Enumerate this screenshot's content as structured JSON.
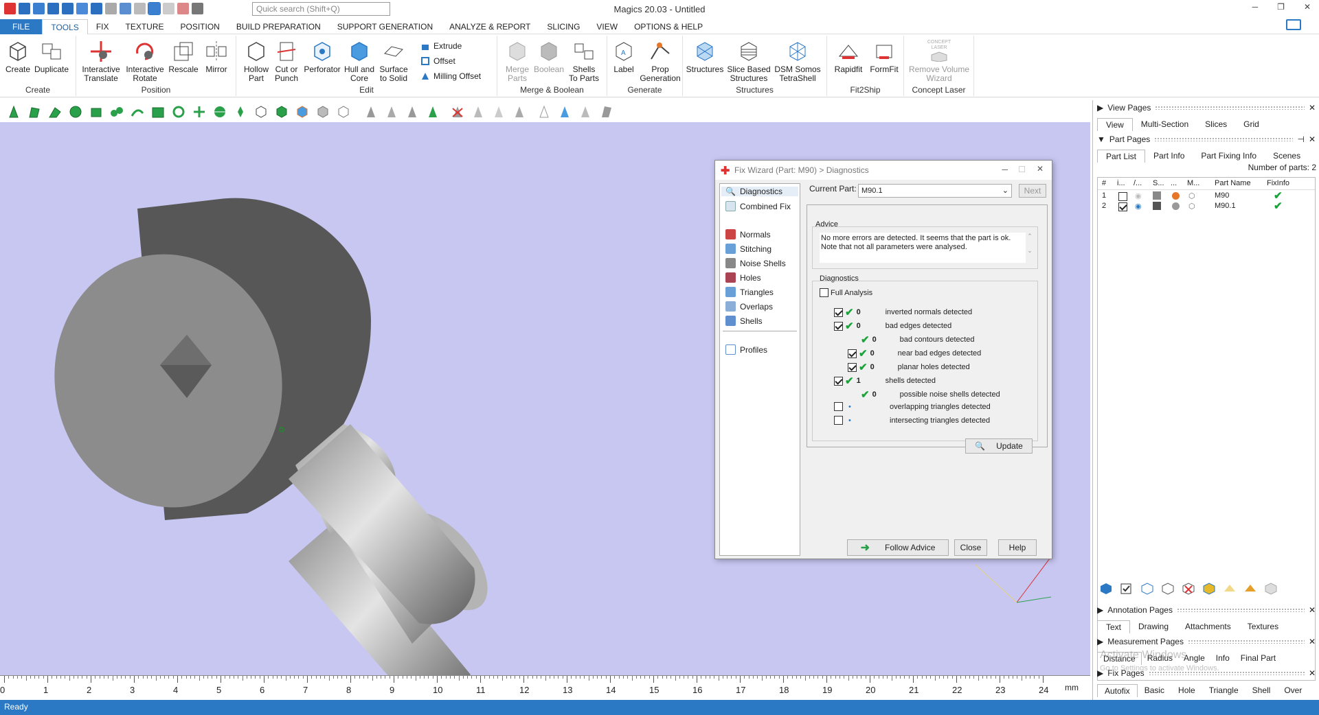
{
  "app": {
    "title": "Magics 20.03 - Untitled",
    "search_placeholder": "Quick search (Shift+Q)"
  },
  "menu": [
    "FILE",
    "TOOLS",
    "FIX",
    "TEXTURE",
    "POSITION",
    "BUILD PREPARATION",
    "SUPPORT GENERATION",
    "ANALYZE & REPORT",
    "SLICING",
    "VIEW",
    "OPTIONS & HELP"
  ],
  "ribbon": {
    "create": {
      "title": "Create",
      "create": "Create",
      "duplicate": "Duplicate"
    },
    "position": {
      "title": "Position",
      "translate1": "Interactive",
      "translate2": "Translate",
      "rotate1": "Interactive",
      "rotate2": "Rotate",
      "rescale": "Rescale",
      "mirror": "Mirror"
    },
    "edit": {
      "title": "Edit",
      "hollow1": "Hollow",
      "hollow2": "Part",
      "cut1": "Cut or",
      "cut2": "Punch",
      "perforator": "Perforator",
      "hull1": "Hull and",
      "hull2": "Core",
      "surface1": "Surface",
      "surface2": "to Solid",
      "extrude": "Extrude",
      "offset": "Offset",
      "milling": "Milling Offset"
    },
    "merge": {
      "title": "Merge & Boolean",
      "merge1": "Merge",
      "merge2": "Parts",
      "boolean": "Boolean",
      "shells1": "Shells",
      "shells2": "To Parts"
    },
    "generate": {
      "title": "Generate",
      "label": "Label",
      "prop1": "Prop",
      "prop2": "Generation"
    },
    "structures": {
      "title": "Structures",
      "structures": "Structures",
      "slice1": "Slice Based",
      "slice2": "Structures",
      "dsm1": "DSM Somos",
      "dsm2": "TetraShell"
    },
    "fit2ship": {
      "title": "Fit2Ship",
      "rapidfit": "Rapidfit",
      "formfit": "FormFit"
    },
    "concept": {
      "title": "Concept Laser",
      "remove1": "Remove Volume",
      "remove2": "Wizard",
      "logo1": "CONCEPT",
      "logo2": "LASER"
    }
  },
  "dialog": {
    "title": "Fix Wizard (Part: M90) > Diagnostics",
    "sidebar": [
      "Diagnostics",
      "Combined Fix",
      "Normals",
      "Stitching",
      "Noise Shells",
      "Holes",
      "Triangles",
      "Overlaps",
      "Shells",
      "Profiles"
    ],
    "current_part_label": "Current Part:",
    "current_part": "M90.1",
    "next": "Next",
    "advice_label": "Advice",
    "advice_text": "No more errors are detected. It seems that the part is ok. Note that not all parameters were analysed.",
    "diagnostics_label": "Diagnostics",
    "full_analysis": "Full Analysis",
    "rows": [
      {
        "count": "0",
        "label": "inverted normals detected"
      },
      {
        "count": "0",
        "label": "bad edges detected"
      },
      {
        "count": "0",
        "label": "bad contours detected"
      },
      {
        "count": "0",
        "label": "near bad edges detected"
      },
      {
        "count": "0",
        "label": "planar holes detected"
      },
      {
        "count": "1",
        "label": "shells detected"
      },
      {
        "count": "0",
        "label": "possible noise shells detected"
      },
      {
        "count": "",
        "label": "overlapping triangles detected"
      },
      {
        "count": "",
        "label": "intersecting triangles detected"
      }
    ],
    "update": "Update",
    "follow_advice": "Follow Advice",
    "close": "Close",
    "help": "Help"
  },
  "right": {
    "view_pages": "View Pages",
    "view_tabs": [
      "View",
      "Multi-Section",
      "Slices",
      "Grid"
    ],
    "part_pages": "Part Pages",
    "part_tabs": [
      "Part List",
      "Part Info",
      "Part Fixing Info",
      "Scenes"
    ],
    "num_parts": "Number of parts: 2",
    "cols": [
      "#",
      "i...",
      "/...",
      "S...",
      "...",
      "M...",
      "Part Name",
      "FixInfo"
    ],
    "parts": [
      {
        "num": "1",
        "name": "M90"
      },
      {
        "num": "2",
        "name": "M90.1"
      }
    ],
    "annotation_pages": "Annotation Pages",
    "annotation_tabs": [
      "Text",
      "Drawing",
      "Attachments",
      "Textures"
    ],
    "measurement_pages": "Measurement Pages",
    "measurement_tabs": [
      "Distance",
      "Radius",
      "Angle",
      "Info",
      "Final Part"
    ],
    "fix_pages": "Fix Pages",
    "fix_tabs": [
      "Autofix",
      "Basic",
      "Hole",
      "Triangle",
      "Shell",
      "Over"
    ],
    "watermark1": "Activate Windows",
    "watermark2": "Go to Settings to activate Windows."
  },
  "ruler": {
    "ticks": [
      "0",
      "1",
      "2",
      "3",
      "4",
      "5",
      "6",
      "7",
      "8",
      "9",
      "10",
      "11",
      "12",
      "13",
      "14",
      "15",
      "16",
      "17",
      "18",
      "19",
      "20",
      "21",
      "22",
      "23",
      "24"
    ],
    "unit": "mm"
  },
  "status": "Ready",
  "colors": {
    "accent": "#2b78c5",
    "viewport": "#c7c7f2",
    "check": "#1aa33a"
  }
}
